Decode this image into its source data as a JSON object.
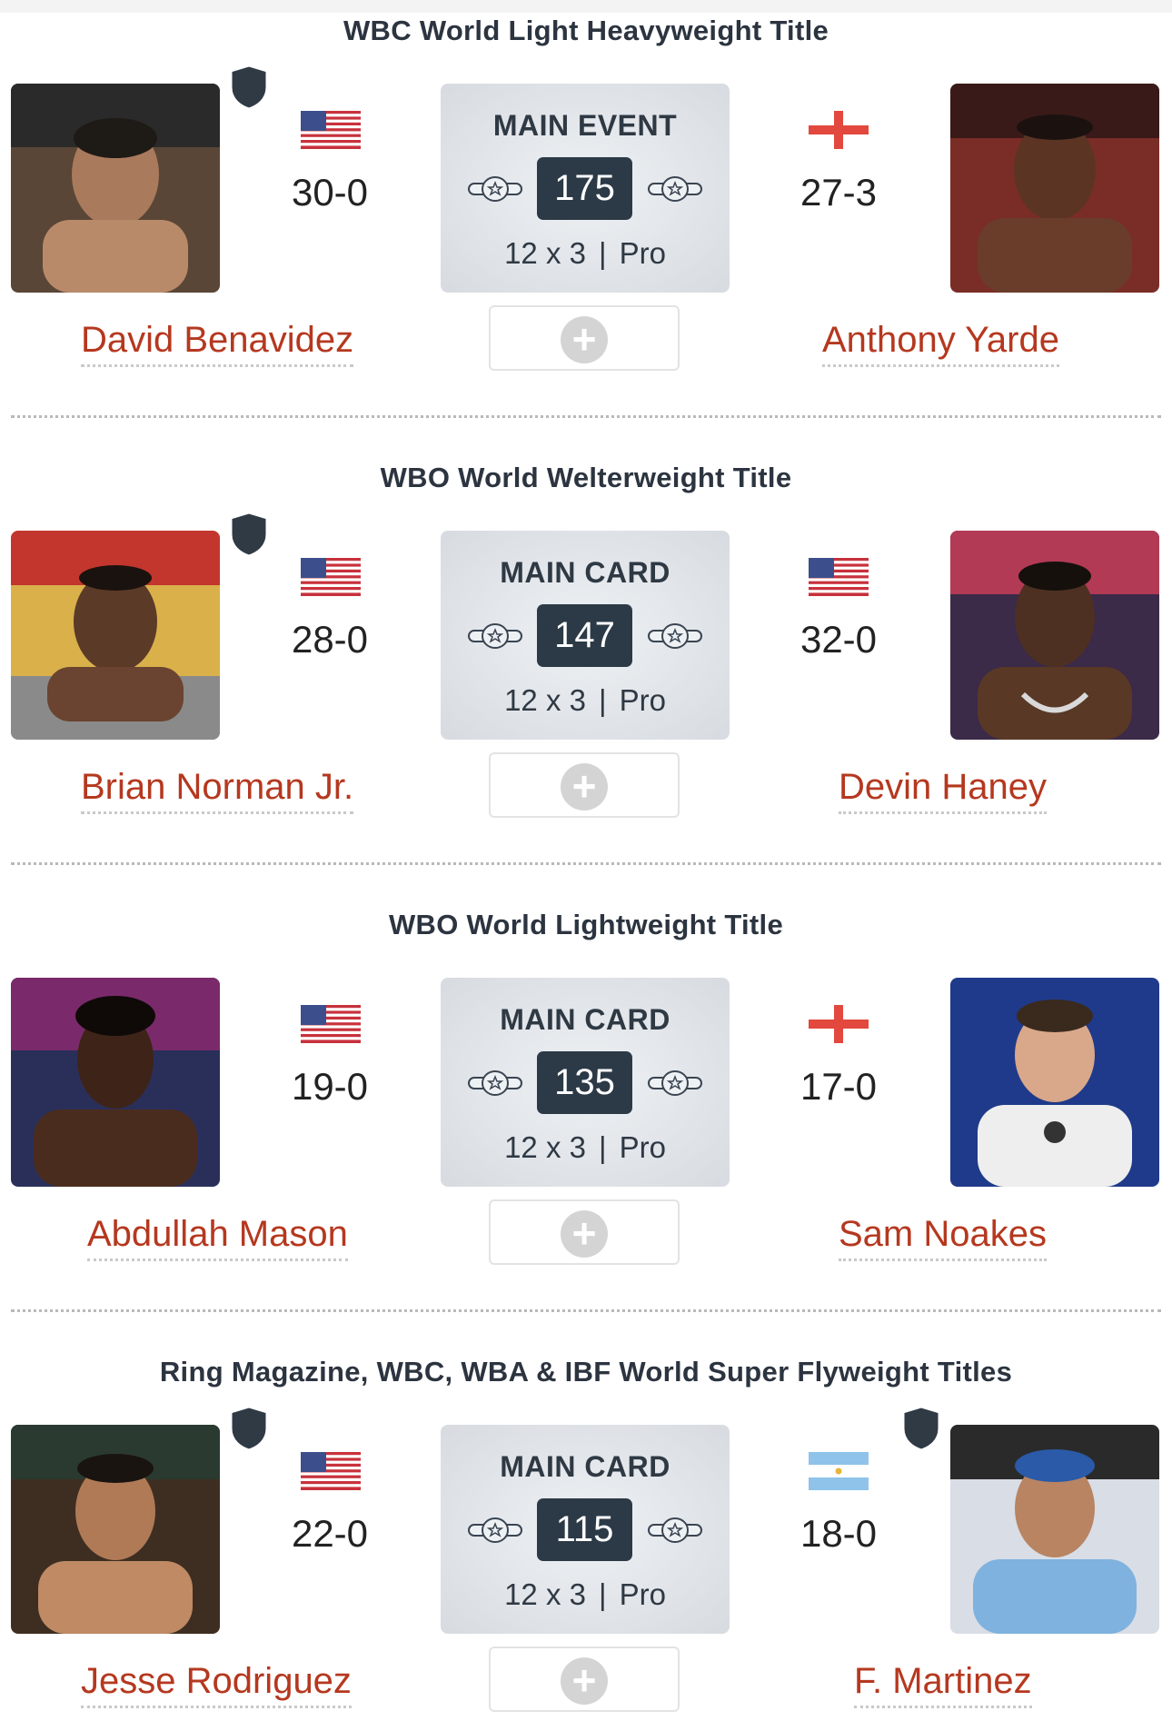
{
  "fights": [
    {
      "title": "WBC World Light Heavyweight Title",
      "card_label": "MAIN EVENT",
      "weight": "175",
      "rounds": "12 x 3",
      "level": "Pro",
      "left": {
        "name": "David Benavidez",
        "record": "30-0",
        "flag": "usa",
        "champion": true
      },
      "right": {
        "name": "Anthony Yarde",
        "record": "27-3",
        "flag": "england",
        "champion": false
      }
    },
    {
      "title": "WBO World Welterweight Title",
      "card_label": "MAIN CARD",
      "weight": "147",
      "rounds": "12 x 3",
      "level": "Pro",
      "left": {
        "name": "Brian Norman Jr.",
        "record": "28-0",
        "flag": "usa",
        "champion": true
      },
      "right": {
        "name": "Devin Haney",
        "record": "32-0",
        "flag": "usa",
        "champion": false
      }
    },
    {
      "title": "WBO World Lightweight Title",
      "card_label": "MAIN CARD",
      "weight": "135",
      "rounds": "12 x 3",
      "level": "Pro",
      "left": {
        "name": "Abdullah Mason",
        "record": "19-0",
        "flag": "usa",
        "champion": false
      },
      "right": {
        "name": "Sam Noakes",
        "record": "17-0",
        "flag": "england",
        "champion": false
      }
    },
    {
      "title": "Ring Magazine, WBC, WBA & IBF World Super Flyweight Titles",
      "card_label": "MAIN CARD",
      "weight": "115",
      "rounds": "12 x 3",
      "level": "Pro",
      "left": {
        "name": "Jesse Rodriguez",
        "record": "22-0",
        "flag": "usa",
        "champion": true
      },
      "right": {
        "name": "F. Martinez",
        "record": "18-0",
        "flag": "argentina",
        "champion": true
      }
    }
  ],
  "separator": "|",
  "add_icon": "+",
  "colors": {
    "name_link": "#b5381f",
    "weight_badge": "#2c3a47",
    "card_bg": "#dfe3e7"
  }
}
